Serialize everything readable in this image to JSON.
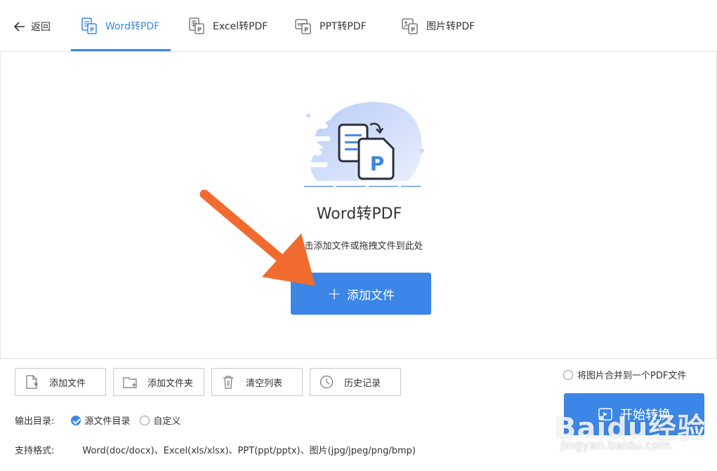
{
  "header": {
    "back_label": "返回",
    "tabs": [
      {
        "label": "Word转PDF",
        "icon": "word-to-pdf-icon",
        "active": true
      },
      {
        "label": "Excel转PDF",
        "icon": "excel-to-pdf-icon",
        "active": false
      },
      {
        "label": "PPT转PDF",
        "icon": "ppt-to-pdf-icon",
        "active": false
      },
      {
        "label": "图片转PDF",
        "icon": "image-to-pdf-icon",
        "active": false
      }
    ]
  },
  "drop_area": {
    "title": "Word转PDF",
    "hint": "点击添加文件或拖拽文件到此处",
    "add_button_label": "添加文件"
  },
  "toolbar": {
    "buttons": [
      {
        "label": "添加文件",
        "icon": "add-file-icon"
      },
      {
        "label": "添加文件夹",
        "icon": "add-folder-icon"
      },
      {
        "label": "清空列表",
        "icon": "trash-icon"
      },
      {
        "label": "历史记录",
        "icon": "history-clock-icon"
      }
    ],
    "merge_option_label": "将图片合并到一个PDF文件",
    "merge_option_checked": false
  },
  "output": {
    "label": "输出目录:",
    "options": [
      {
        "label": "源文件目录",
        "checked": true
      },
      {
        "label": "自定义",
        "checked": false
      }
    ]
  },
  "formats": {
    "label": "支持格式:",
    "value": "Word(doc/docx)、Excel(xls/xlsx)、PPT(ppt/pptx)、图片(jpg/jpeg/png/bmp)"
  },
  "start_button_label": "开始转换",
  "watermark": {
    "logo": "Baidu经验",
    "url": "jingyan.baidu.com"
  },
  "colors": {
    "accent": "#3b86e6",
    "annotation_arrow": "#f26b2e"
  }
}
